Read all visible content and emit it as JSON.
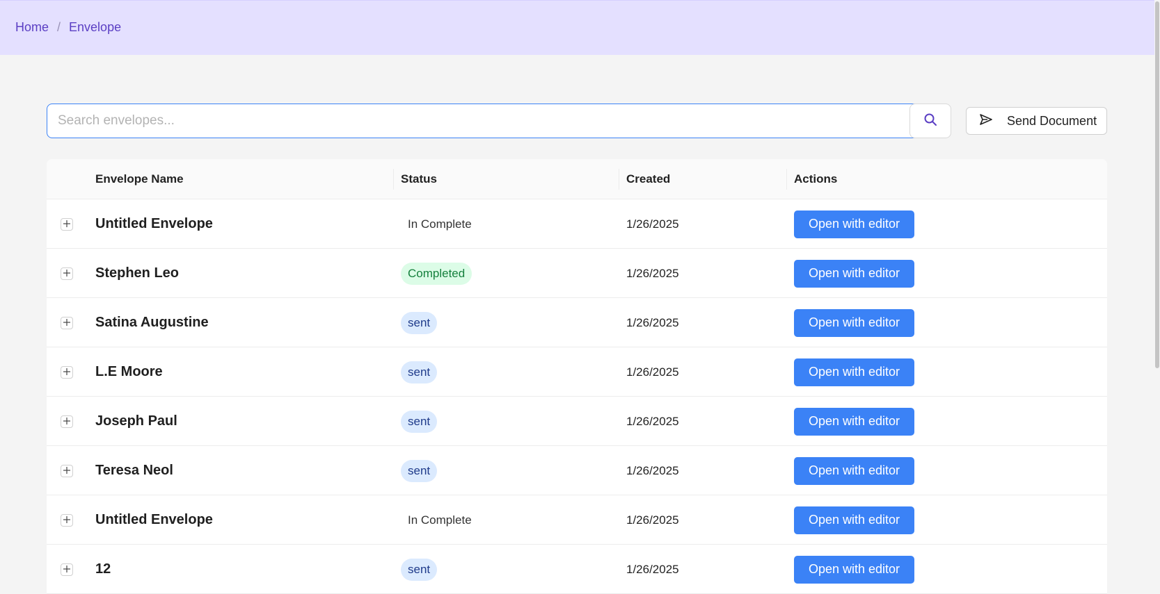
{
  "breadcrumb": {
    "home": "Home",
    "separator": "/",
    "current": "Envelope"
  },
  "search": {
    "placeholder": "Search envelopes...",
    "value": "",
    "icon": "search-icon"
  },
  "send_document": {
    "label": "Send Document",
    "icon": "send-icon"
  },
  "table": {
    "columns": {
      "name": "Envelope Name",
      "status": "Status",
      "created": "Created",
      "actions": "Actions"
    },
    "rows": [
      {
        "name": "Untitled Envelope",
        "status": "In Complete",
        "status_type": "incomplete",
        "created": "1/26/2025",
        "action": "Open with editor"
      },
      {
        "name": "Stephen Leo",
        "status": "Completed",
        "status_type": "completed",
        "created": "1/26/2025",
        "action": "Open with editor"
      },
      {
        "name": "Satina Augustine",
        "status": "sent",
        "status_type": "sent",
        "created": "1/26/2025",
        "action": "Open with editor"
      },
      {
        "name": "L.E Moore",
        "status": "sent",
        "status_type": "sent",
        "created": "1/26/2025",
        "action": "Open with editor"
      },
      {
        "name": "Joseph Paul",
        "status": "sent",
        "status_type": "sent",
        "created": "1/26/2025",
        "action": "Open with editor"
      },
      {
        "name": "Teresa Neol",
        "status": "sent",
        "status_type": "sent",
        "created": "1/26/2025",
        "action": "Open with editor"
      },
      {
        "name": "Untitled Envelope",
        "status": "In Complete",
        "status_type": "incomplete",
        "created": "1/26/2025",
        "action": "Open with editor"
      },
      {
        "name": "12",
        "status": "sent",
        "status_type": "sent",
        "created": "1/26/2025",
        "action": "Open with editor"
      }
    ]
  },
  "colors": {
    "topbar_bg": "#e4e0ff",
    "breadcrumb": "#5b3fc4",
    "primary_button": "#3b82f6",
    "completed_bg": "#dcfce7",
    "completed_text": "#15803d",
    "sent_bg": "#dbeafe",
    "sent_text": "#1e3a8a"
  }
}
